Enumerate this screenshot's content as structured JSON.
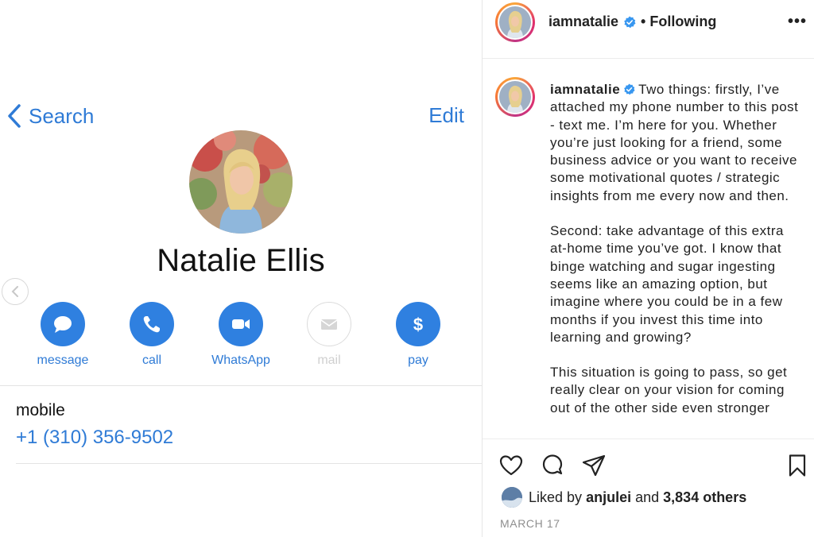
{
  "contact": {
    "back_label": "Search",
    "edit_label": "Edit",
    "name": "Natalie Ellis",
    "actions": [
      {
        "label": "message",
        "icon": "message-bubble-icon",
        "enabled": true
      },
      {
        "label": "call",
        "icon": "phone-icon",
        "enabled": true
      },
      {
        "label": "WhatsApp",
        "icon": "video-camera-icon",
        "enabled": true
      },
      {
        "label": "mail",
        "icon": "mail-envelope-icon",
        "enabled": false
      },
      {
        "label": "pay",
        "icon": "dollar-icon",
        "enabled": true
      }
    ],
    "phone_label": "mobile",
    "phone_number": "+1 (310) 356-9502"
  },
  "instagram": {
    "header": {
      "username": "iamnatalie",
      "dot": "•",
      "follow_status": "Following",
      "more": "•••"
    },
    "caption": {
      "username": "iamnatalie",
      "paragraph_1": "Two things: firstly, I’ve attached my phone number to this post - text me. I’m here for you. Whether you’re just looking for a friend, some business advice or you want to receive some motivational quotes / strategic insights from me every now and then.",
      "paragraph_2": "Second: take advantage of this extra at-home time you’ve got. I know that binge watching and sugar ingesting seems like an amazing option, but imagine where you could be in a few months if you invest this time into learning and growing?",
      "paragraph_3": "This situation is going to pass, so get really clear on your vision for coming out of the other side even stronger"
    },
    "likes": {
      "prefix": "Liked by",
      "user": "anjulei",
      "middle": "and",
      "others": "3,834 others"
    },
    "date": "MARCH 17"
  },
  "colors": {
    "ios_blue": "#2f7bd6",
    "button_blue": "#2f80e0",
    "verified_blue": "#3897f0",
    "muted_gray": "#8e8e8e"
  }
}
